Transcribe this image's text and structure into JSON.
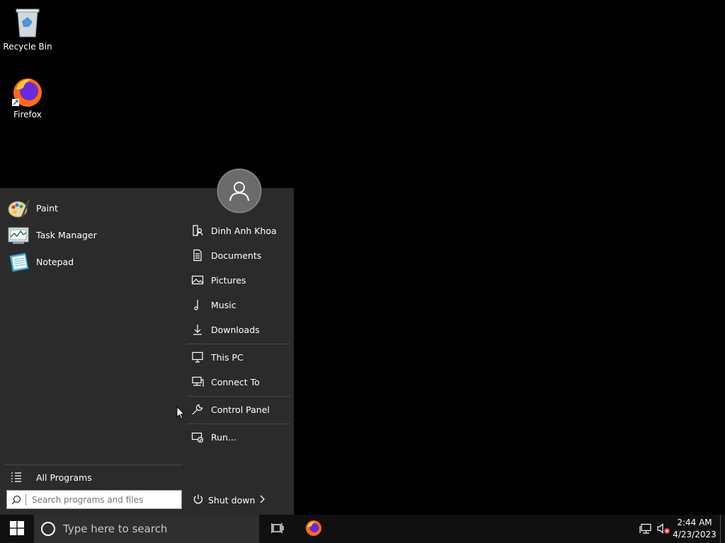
{
  "desktop": {
    "icons": [
      {
        "label": "Recycle Bin",
        "icon": "recycle-bin-icon"
      },
      {
        "label": "Firefox",
        "icon": "firefox-icon"
      }
    ]
  },
  "start_menu": {
    "user_avatar_icon": "user-avatar-icon",
    "pinned": [
      {
        "label": "Paint",
        "icon": "paint-icon"
      },
      {
        "label": "Task Manager",
        "icon": "task-manager-icon"
      },
      {
        "label": "Notepad",
        "icon": "notepad-icon"
      }
    ],
    "right": {
      "user": {
        "label": "Dinh Anh Khoa",
        "icon": "user-folder-icon"
      },
      "documents": {
        "label": "Documents",
        "icon": "document-icon"
      },
      "pictures": {
        "label": "Pictures",
        "icon": "picture-icon"
      },
      "music": {
        "label": "Music",
        "icon": "music-note-icon"
      },
      "downloads": {
        "label": "Downloads",
        "icon": "download-icon"
      },
      "this_pc": {
        "label": "This PC",
        "icon": "computer-icon"
      },
      "connect_to": {
        "label": "Connect To",
        "icon": "network-icon"
      },
      "control_panel": {
        "label": "Control Panel",
        "icon": "wrench-icon"
      },
      "run": {
        "label": "Run...",
        "icon": "run-icon"
      }
    },
    "all_programs": "All Programs",
    "search_placeholder": "Search programs and files",
    "shutdown": "Shut down"
  },
  "taskbar": {
    "search_placeholder": "Type here to search",
    "time": "2:44 AM",
    "date": "4/23/2023"
  }
}
